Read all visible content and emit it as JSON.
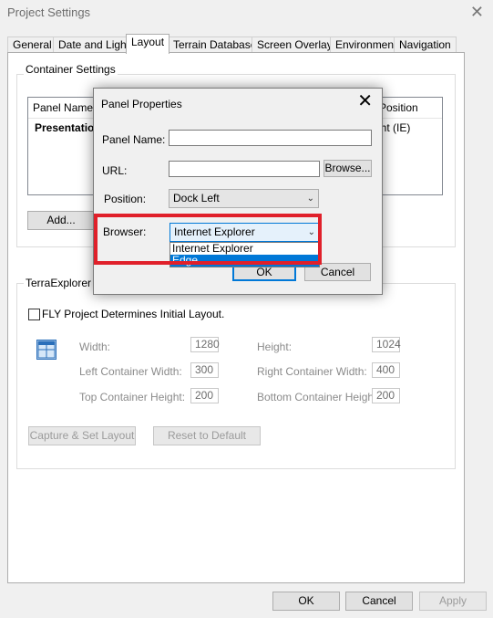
{
  "window": {
    "title": "Project Settings",
    "close_glyph": "✕"
  },
  "tabs": [
    {
      "label": "General"
    },
    {
      "label": "Date and Light"
    },
    {
      "label": "Layout"
    },
    {
      "label": "Terrain Database"
    },
    {
      "label": "Screen Overlay"
    },
    {
      "label": "Environment"
    },
    {
      "label": "Navigation"
    }
  ],
  "container_settings": {
    "label": "Container Settings",
    "columns": [
      "Panel Name",
      "Position"
    ],
    "rows": [
      {
        "name": "Presentation",
        "position": "ght (IE)"
      }
    ],
    "add_button": "Add..."
  },
  "terraexplorer": {
    "label": "TerraExplorer W",
    "fly_checkbox_label": "FLY Project Determines Initial Layout.",
    "fly_checked": false,
    "width_label": "Width:",
    "width_value": "1280",
    "height_label": "Height:",
    "height_value": "1024",
    "left_label": "Left Container Width:",
    "left_value": "300",
    "right_label": "Right Container Width:",
    "right_value": "400",
    "top_label": "Top Container Height:",
    "top_value": "200",
    "bottom_label": "Bottom Container Height:",
    "bottom_value": "200",
    "capture_button": "Capture & Set Layout",
    "reset_button": "Reset to Default"
  },
  "footer": {
    "ok": "OK",
    "cancel": "Cancel",
    "apply": "Apply"
  },
  "dialog": {
    "title": "Panel Properties",
    "close_glyph": "✕",
    "panel_name_label": "Panel Name:",
    "panel_name_value": "",
    "url_label": "URL:",
    "url_value": "",
    "browse_button": "Browse...",
    "position_label": "Position:",
    "position_value": "Dock Left",
    "browser_label": "Browser:",
    "browser_value": "Internet Explorer",
    "browser_options": [
      "Internet Explorer",
      "Edge"
    ],
    "browser_highlighted": "Edge",
    "ok": "OK",
    "cancel": "Cancel"
  },
  "colors": {
    "accent": "#0078d7",
    "highlight_border": "#e0202a"
  }
}
